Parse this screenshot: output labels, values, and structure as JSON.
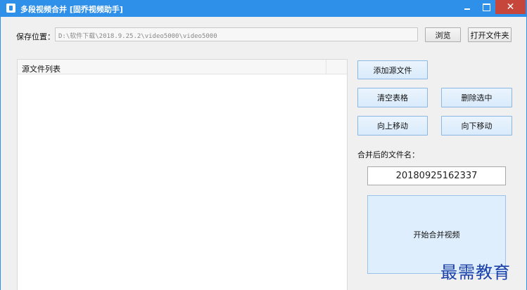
{
  "window": {
    "title": "多段视频合并 [固乔视频助手]",
    "title_bar_color": "#2e90e8",
    "close_color": "#c7463b"
  },
  "save": {
    "label": "保存位置：",
    "path": "D:\\软件下载\\2018.9.25.2\\video5000\\video5000",
    "browse_label": "浏览",
    "open_folder_label": "打开文件夹"
  },
  "source_list": {
    "header": "源文件列表"
  },
  "actions": {
    "add_label": "添加源文件",
    "clear_label": "清空表格",
    "delete_label": "删除选中",
    "move_up_label": "向上移动",
    "move_down_label": "向下移动"
  },
  "merge": {
    "label": "合并后的文件名：",
    "filename": "20180925162337",
    "start_label": "开始合并视频"
  },
  "watermark": {
    "text": "最需教育"
  }
}
